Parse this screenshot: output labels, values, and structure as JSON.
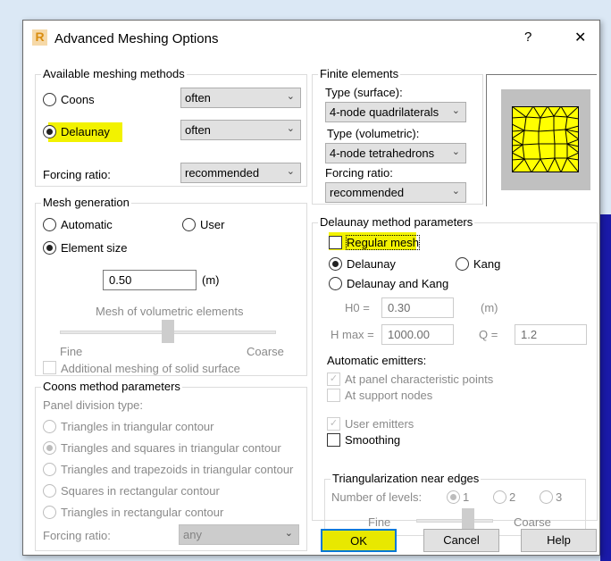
{
  "title": "Advanced Meshing Options",
  "help_label": "?",
  "close_label": "✕",
  "available_methods": {
    "legend": "Available meshing methods",
    "coons": {
      "label": "Coons",
      "value": "often",
      "selected": false
    },
    "delaunay": {
      "label": "Delaunay",
      "value": "often",
      "selected": true
    },
    "forcing_label": "Forcing ratio:",
    "forcing_value": "recommended"
  },
  "mesh_generation": {
    "legend": "Mesh generation",
    "automatic": "Automatic",
    "user": "User",
    "element_size": "Element size",
    "size_value": "0.50",
    "unit": "(m)",
    "volumetric_label": "Mesh of volumetric elements",
    "fine": "Fine",
    "coarse": "Coarse",
    "slider_value": 0.5,
    "additional": "Additional meshing of solid surface"
  },
  "coons_params": {
    "legend": "Coons method parameters",
    "panel_division": "Panel division type:",
    "options": [
      "Triangles in triangular contour",
      "Triangles and squares in triangular contour",
      "Triangles and trapezoids in triangular contour",
      "Squares in rectangular contour",
      "Triangles in rectangular contour"
    ],
    "selected_index": 1,
    "forcing_label": "Forcing ratio:",
    "forcing_value": "any"
  },
  "finite_elements": {
    "legend": "Finite elements",
    "surface_label": "Type (surface):",
    "surface_value": "4-node quadrilaterals",
    "volumetric_label": "Type (volumetric):",
    "volumetric_value": "4-node tetrahedrons",
    "forcing_label": "Forcing ratio:",
    "forcing_value": "recommended"
  },
  "delaunay_params": {
    "legend": "Delaunay method parameters",
    "regular_mesh": "Regular mesh",
    "delaunay": "Delaunay",
    "kang": "Kang",
    "delaunay_kang": "Delaunay and Kang",
    "h0_label": "H0 =",
    "h0_value": "0.30",
    "h0_unit": "(m)",
    "hmax_label": "H max =",
    "hmax_value": "1000.00",
    "q_label": "Q =",
    "q_value": "1.2",
    "emitters_label": "Automatic emitters:",
    "at_panel": "At panel characteristic points",
    "at_support": "At support nodes",
    "user_emitters": "User emitters",
    "smoothing": "Smoothing",
    "tri_legend": "Triangularization near edges",
    "levels_label": "Number of levels:",
    "levels": [
      "1",
      "2",
      "3"
    ],
    "fine": "Fine",
    "coarse": "Coarse",
    "slider_value": 0.6
  },
  "buttons": {
    "ok": "OK",
    "cancel": "Cancel",
    "help": "Help"
  },
  "colors": {
    "highlight": "#f2f200",
    "mesh_fill": "#ffff00"
  }
}
